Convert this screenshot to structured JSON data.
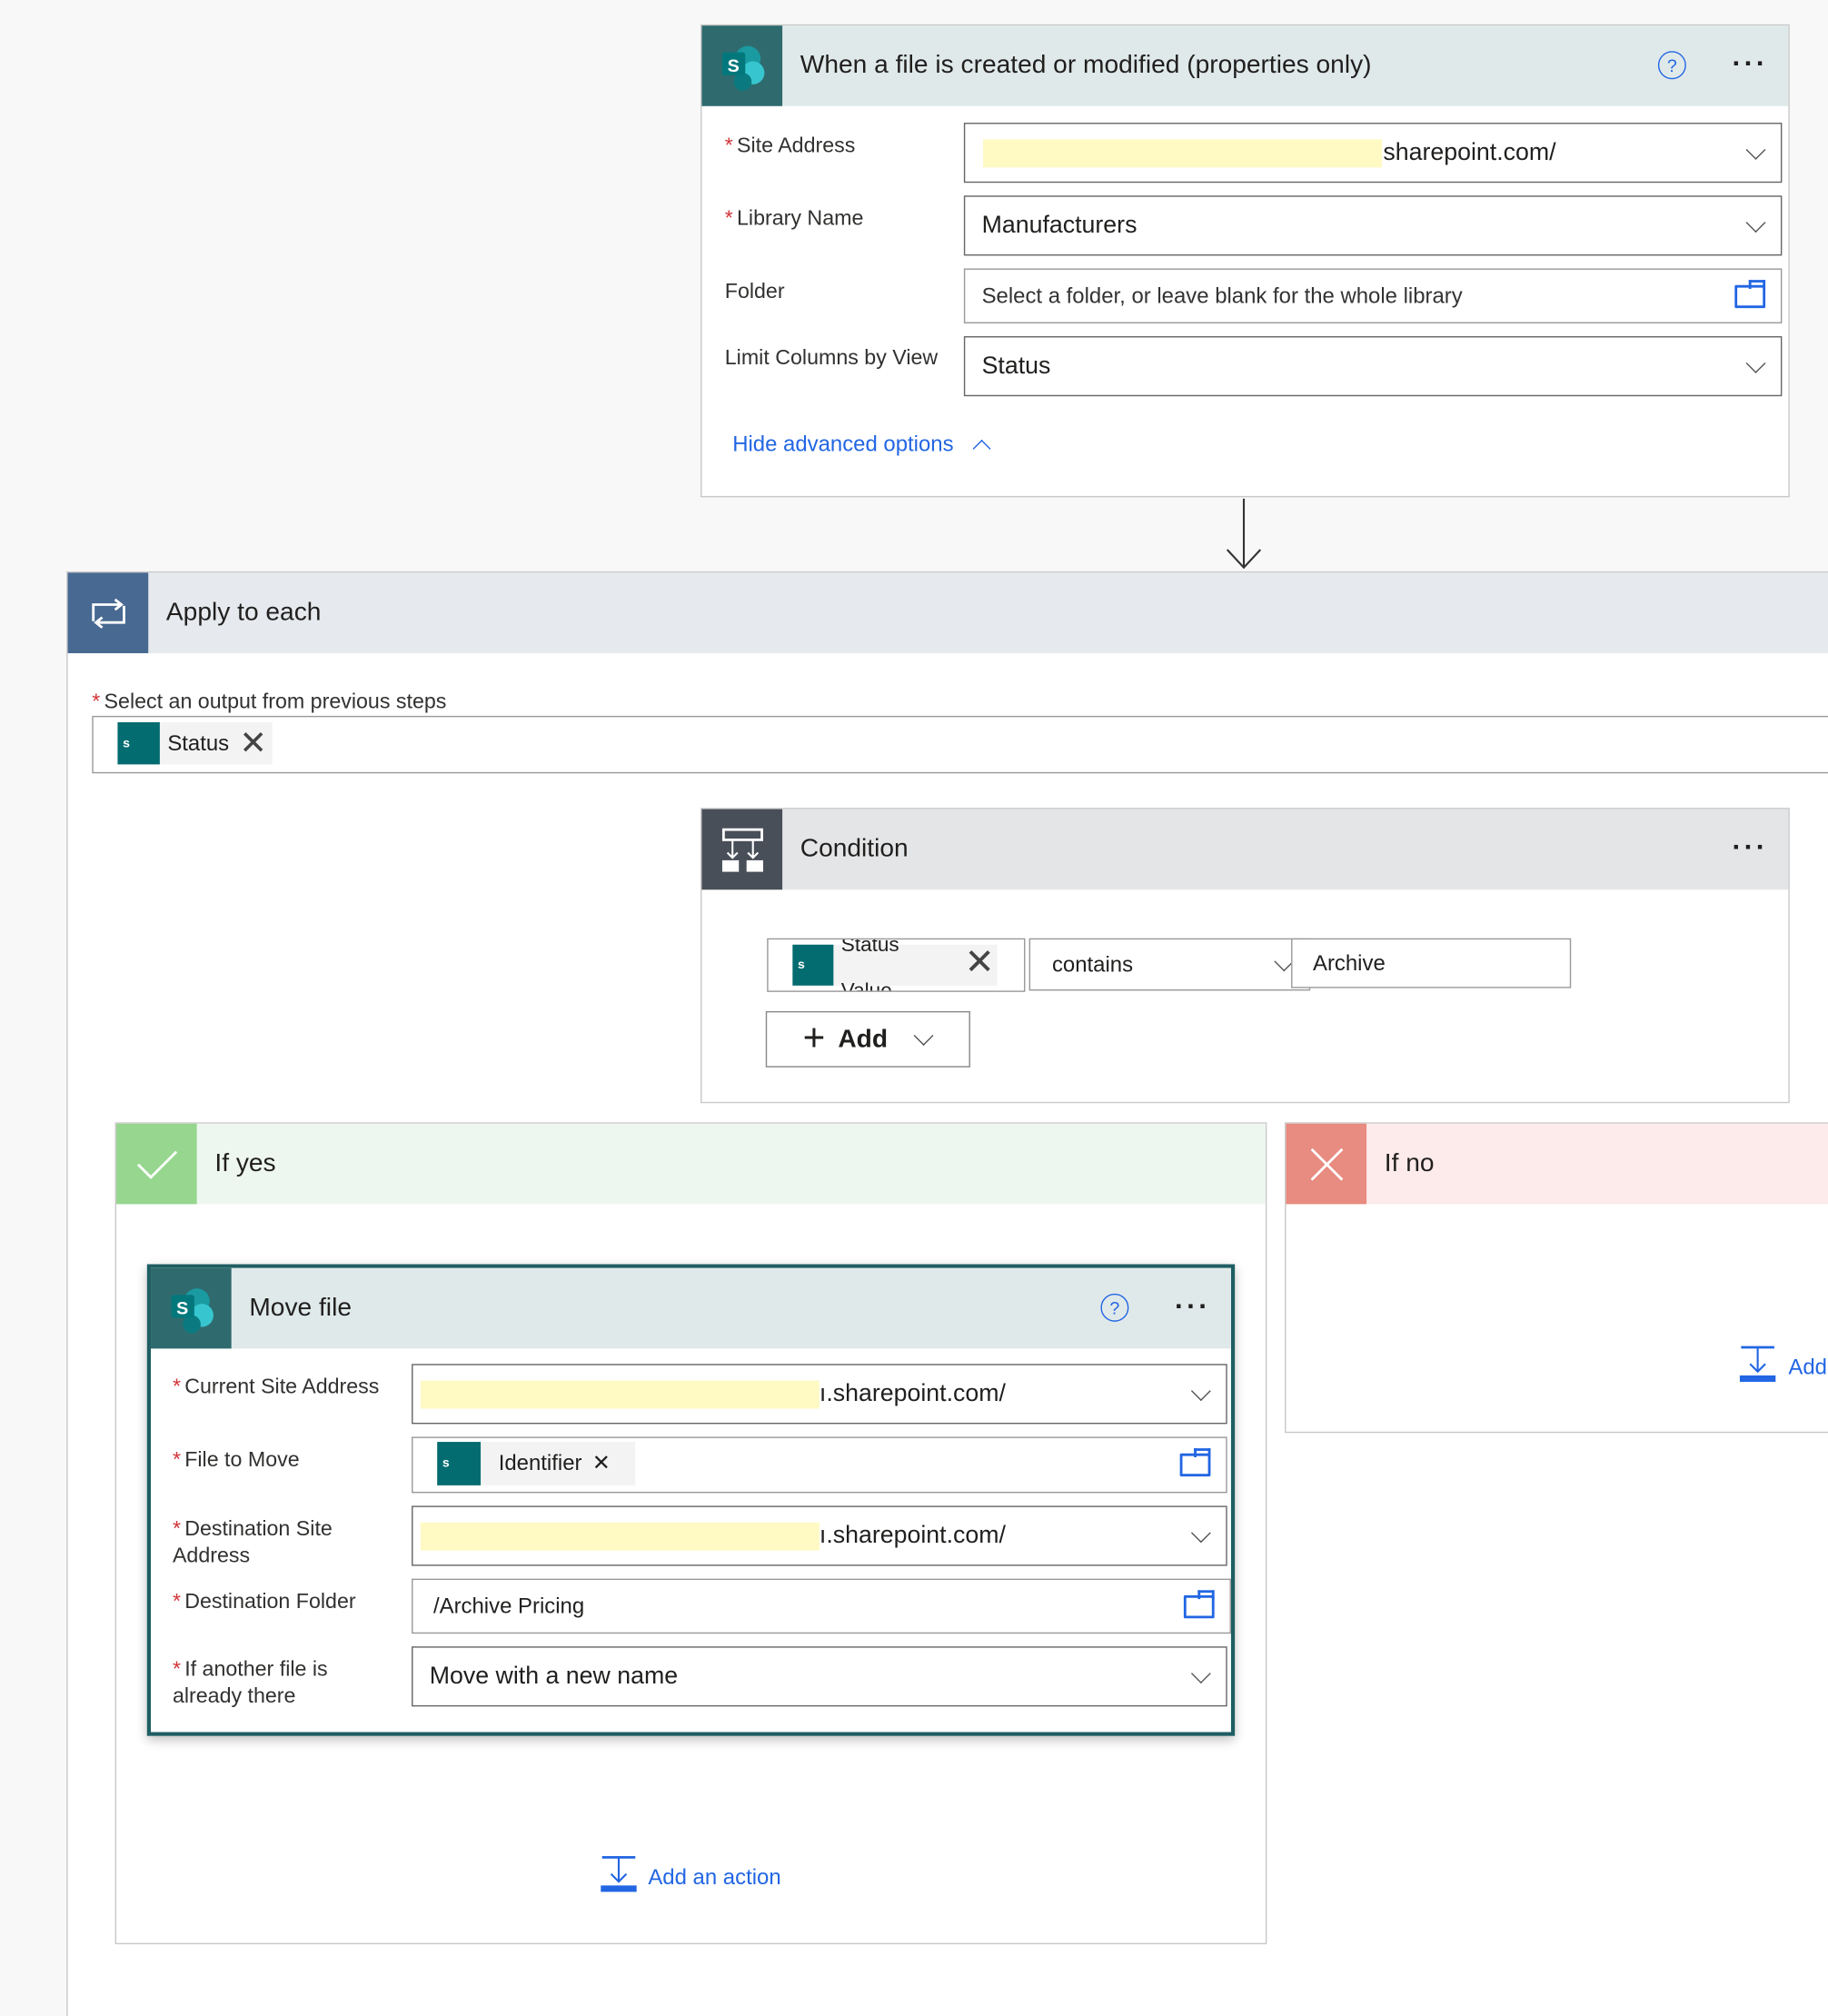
{
  "trigger": {
    "title": "When a file is created or modified (properties only)",
    "icon": "sharepoint-icon",
    "fields": [
      {
        "label": "Site Address",
        "required": true,
        "value": "sharepoint.com/"
      },
      {
        "label": "Library Name",
        "required": true,
        "value": "Manufacturers"
      },
      {
        "label": "Folder",
        "required": false,
        "placeholder": "Select a folder, or leave blank for the whole library"
      },
      {
        "label": "Limit Columns by View",
        "required": false,
        "value": "Status"
      }
    ],
    "advanced_link": "Hide advanced options"
  },
  "apply_each": {
    "title": "Apply to each",
    "select_label": "Select an output from previous steps",
    "token": "Status"
  },
  "condition": {
    "title": "Condition",
    "token_line1": "Status",
    "token_line2": "Value",
    "operator": "contains",
    "value": "Archive",
    "add_label": "Add"
  },
  "if_yes": {
    "title": "If yes",
    "add_action": "Add an action"
  },
  "if_no": {
    "title": "If no",
    "add_action": "Add"
  },
  "move_file": {
    "title": "Move file",
    "fields": [
      {
        "label": "Current Site Address",
        "required": true,
        "value": "ı.sharepoint.com/"
      },
      {
        "label": "File to Move",
        "required": true,
        "token": "Identifier"
      },
      {
        "label": "Destination Site Address",
        "required": true,
        "value": "ı.sharepoint.com/"
      },
      {
        "label": "Destination Folder",
        "required": true,
        "value": "/Archive Pricing"
      },
      {
        "label": "If another file is already there",
        "required": true,
        "value": "Move with a new name"
      }
    ]
  },
  "colors": {
    "sharepoint": "#036c70",
    "loop": "#486991",
    "condition": "#484f58",
    "yes": "#8fd18f",
    "no": "#e8897f",
    "link": "#2266e3",
    "required": "#d13438"
  }
}
